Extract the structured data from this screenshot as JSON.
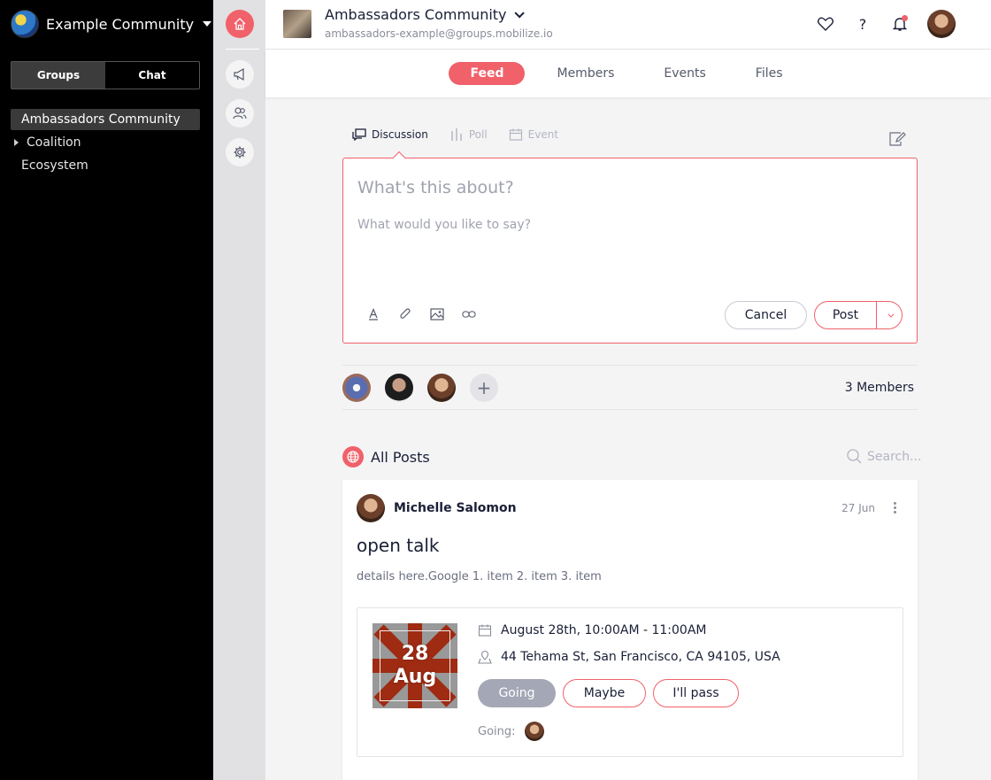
{
  "sidebar": {
    "community_name": "Example Community",
    "segments": [
      "Groups",
      "Chat"
    ],
    "active_segment": "Groups",
    "groups": [
      {
        "label": "Ambassadors Community",
        "active": true,
        "expandable": false
      },
      {
        "label": "Coalition",
        "active": false,
        "expandable": true
      },
      {
        "label": "Ecosystem",
        "active": false,
        "expandable": false
      }
    ]
  },
  "rail": {
    "icons": [
      "home-icon",
      "megaphone-icon",
      "people-icon",
      "gear-icon"
    ],
    "accent": "#f0616a"
  },
  "header": {
    "group_title": "Ambassadors Community",
    "group_email": "ambassadors-example@groups.mobilize.io",
    "icons": [
      "heart-icon",
      "help-icon",
      "bell-icon",
      "user-avatar"
    ]
  },
  "tabs": [
    {
      "label": "Feed",
      "active": true
    },
    {
      "label": "Members",
      "active": false
    },
    {
      "label": "Events",
      "active": false
    },
    {
      "label": "Files",
      "active": false
    }
  ],
  "compose": {
    "types": [
      {
        "label": "Discussion",
        "active": true
      },
      {
        "label": "Poll",
        "active": false
      },
      {
        "label": "Event",
        "active": false
      }
    ],
    "subject_placeholder": "What's this about?",
    "body_placeholder": "What would you like to say?",
    "cancel_label": "Cancel",
    "post_label": "Post"
  },
  "members": {
    "count_label": "3 Members",
    "add_symbol": "+"
  },
  "posts": {
    "heading": "All Posts",
    "search_placeholder": "Search...",
    "items": [
      {
        "author": "Michelle Salomon",
        "date": "27 Jun",
        "title": "open talk",
        "body": "details here.Google 1. item 2. item 3. item",
        "event": {
          "day": "28",
          "month": "Aug",
          "datetime": "August 28th, 10:00AM - 11:00AM",
          "location": "44 Tehama St, San Francisco, CA 94105, USA",
          "rsvp": {
            "going": "Going",
            "maybe": "Maybe",
            "pass": "I'll pass"
          },
          "going_label": "Going:"
        }
      }
    ]
  }
}
